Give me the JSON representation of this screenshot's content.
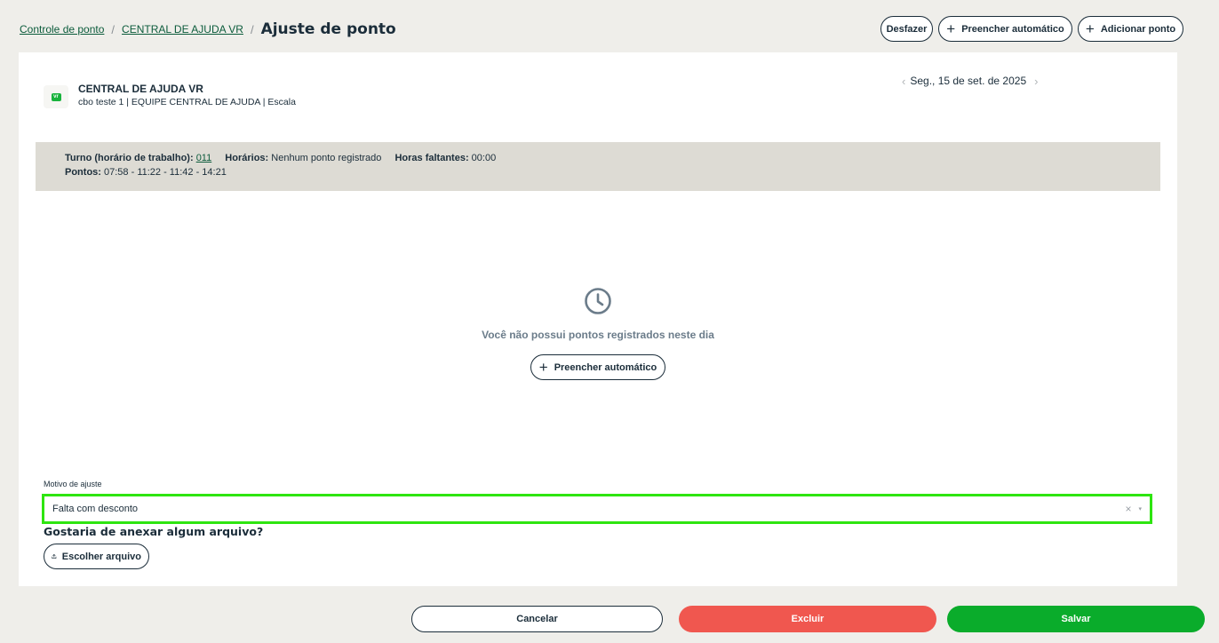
{
  "breadcrumb": {
    "items": [
      "Controle de ponto",
      "CENTRAL DE AJUDA VR"
    ],
    "separator": "/",
    "current": "Ajuste de ponto"
  },
  "toolbar": {
    "undo_label": "Desfazer",
    "autofill_label": "Preencher automático",
    "add_label": "Adicionar ponto"
  },
  "employee": {
    "logo_text": "vr",
    "company": "CENTRAL DE AJUDA VR",
    "details": "cbo teste 1 | EQUIPE CENTRAL DE AJUDA | Escala"
  },
  "date_nav": {
    "prev": "‹",
    "date": "Seg., 15 de set. de 2025",
    "next": "›"
  },
  "summary": {
    "turno_label": "Turno (horário de trabalho):",
    "turno_value": "011",
    "horarios_label": "Horários:",
    "horarios_value": "Nenhum ponto registrado",
    "faltantes_label": "Horas faltantes:",
    "faltantes_value": "00:00",
    "pontos_label": "Pontos:",
    "pontos_value": "07:58 - 11:22 - 11:42 - 14:21"
  },
  "empty_state": {
    "icon": "clock-icon",
    "message": "Você não possui pontos registrados neste dia",
    "button_label": "Preencher automático"
  },
  "motivo": {
    "label": "Motivo de ajuste",
    "value": "Falta com desconto",
    "clear": "×",
    "caret": "▾"
  },
  "attachment": {
    "question": "Gostaria de anexar algum arquivo?",
    "button_label": "Escolher arquivo"
  },
  "footer": {
    "cancel": "Cancelar",
    "delete": "Excluir",
    "save": "Salvar"
  },
  "colors": {
    "accent_green": "#0aac2b",
    "danger": "#f0574f",
    "highlight": "#2ee510",
    "info_band": "#dddbd4"
  }
}
